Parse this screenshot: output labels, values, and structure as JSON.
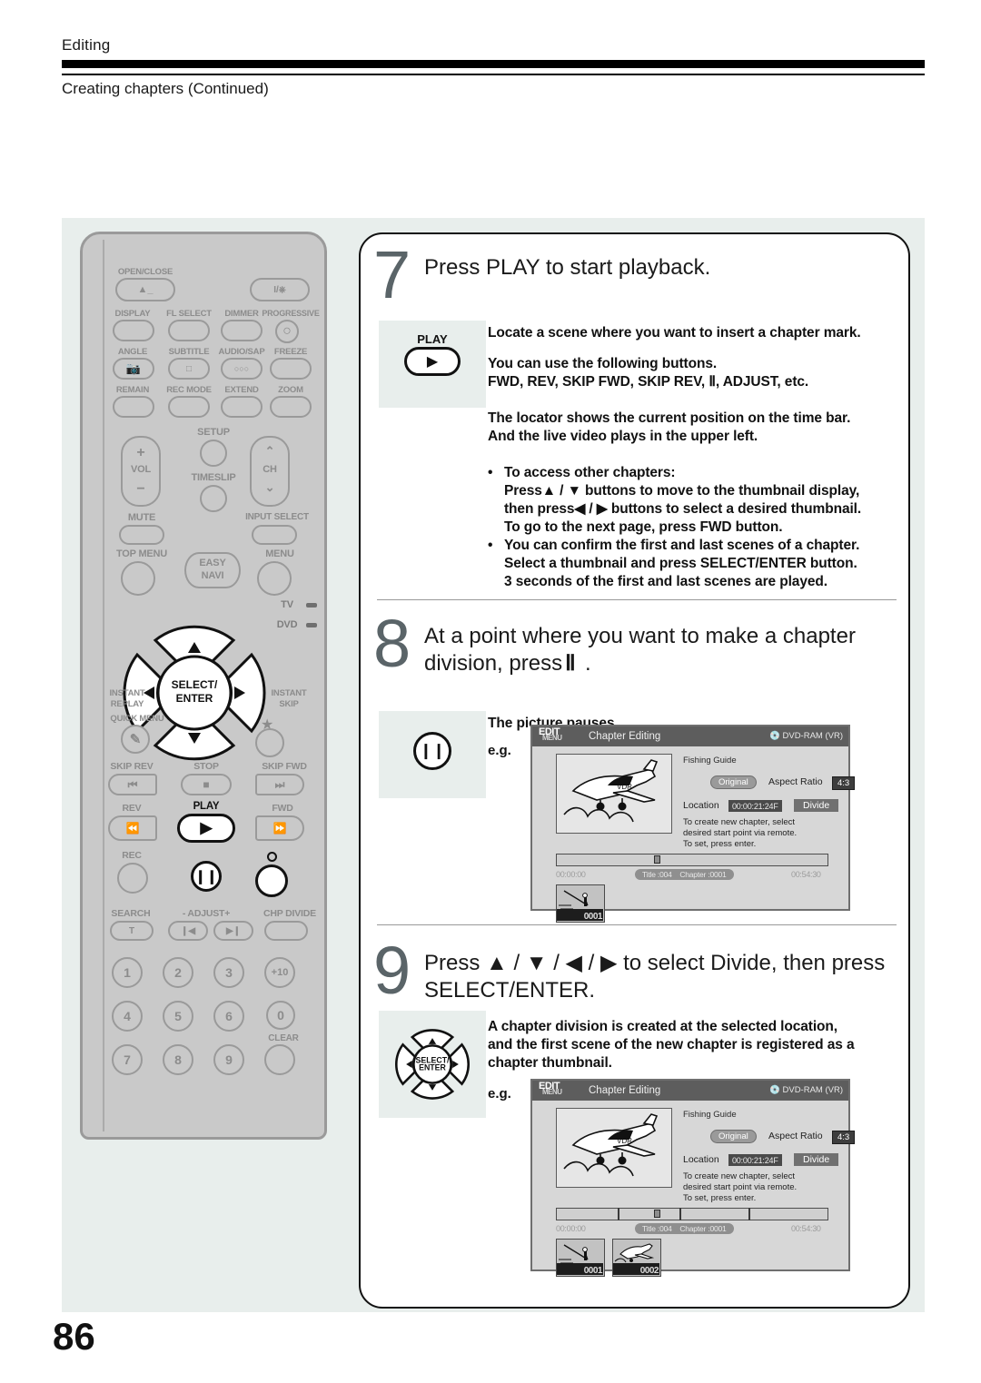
{
  "header": {
    "section": "Editing",
    "subtitle": "Creating chapters (Continued)"
  },
  "page_number": "86",
  "remote": {
    "groups": [
      {
        "label": "OPEN/CLOSE",
        "icon": "eject-icon"
      },
      {
        "label": "",
        "icon": "power-icon",
        "glyph": "I/⏻"
      },
      {
        "label": "DISPLAY"
      },
      {
        "label": "FL SELECT"
      },
      {
        "label": "DIMMER"
      },
      {
        "label": "PROGRESSIVE"
      },
      {
        "label": "ANGLE",
        "icon": "camera-icon"
      },
      {
        "label": "SUBTITLE",
        "icon": "subtitle-icon"
      },
      {
        "label": "AUDIO/SAP",
        "icon": "audio-icon"
      },
      {
        "label": "FREEZE"
      },
      {
        "label": "REMAIN"
      },
      {
        "label": "REC MODE"
      },
      {
        "label": "EXTEND"
      },
      {
        "label": "ZOOM"
      },
      {
        "label": "VOL"
      },
      {
        "label": "SETUP"
      },
      {
        "label": "TIMESLIP"
      },
      {
        "label": "CH"
      },
      {
        "label": "MUTE"
      },
      {
        "label": "INPUT SELECT"
      },
      {
        "label": "TOP MENU"
      },
      {
        "label": "EASY NAVI"
      },
      {
        "label": "MENU"
      },
      {
        "label": "SELECT/ENTER"
      },
      {
        "label": "INSTANT REPLAY"
      },
      {
        "label": "INSTANT SKIP"
      },
      {
        "label": "QUICK MENU"
      },
      {
        "label": "SKIP REV"
      },
      {
        "label": "STOP"
      },
      {
        "label": "SKIP FWD"
      },
      {
        "label": "REV"
      },
      {
        "label": "PLAY"
      },
      {
        "label": "FWD"
      },
      {
        "label": "REC"
      },
      {
        "label": "SEARCH"
      },
      {
        "label": "- ADJUST+"
      },
      {
        "label": "CHP DIVIDE"
      },
      {
        "label": "CLEAR"
      }
    ],
    "labels": {
      "open_close": "OPEN/CLOSE",
      "display": "DISPLAY",
      "fl_select": "FL SELECT",
      "dimmer": "DIMMER",
      "progressive": "PROGRESSIVE",
      "angle": "ANGLE",
      "subtitle": "SUBTITLE",
      "audio_sap": "AUDIO/SAP",
      "freeze": "FREEZE",
      "remain": "REMAIN",
      "rec_mode": "REC MODE",
      "extend": "EXTEND",
      "zoom": "ZOOM",
      "vol": "VOL",
      "setup": "SETUP",
      "timeslip": "TIMESLIP",
      "ch": "CH",
      "mute": "MUTE",
      "input_select": "INPUT SELECT",
      "top_menu": "TOP MENU",
      "easy": "EASY",
      "navi": "NAVI",
      "menu": "MENU",
      "select": "SELECT/",
      "enter": "ENTER",
      "tv": "TV",
      "dvd": "DVD",
      "instant": "INSTANT",
      "replay": "REPLAY",
      "instant2": "INSTANT",
      "skip": "SKIP",
      "quick_menu": "QUICK MENU",
      "skip_rev": "SKIP REV",
      "stop": "STOP",
      "skip_fwd": "SKIP FWD",
      "rev": "REV",
      "play": "PLAY",
      "fwd": "FWD",
      "rec": "REC",
      "search": "SEARCH",
      "adjust": "- ADJUST+",
      "chp_divide": "CHP DIVIDE",
      "clear": "CLEAR",
      "search_glyph": "T",
      "plus": "+",
      "minus": "−",
      "chev_up": "⌃",
      "chev_down": "⌄"
    },
    "keypad": [
      "1",
      "2",
      "3",
      "+10",
      "4",
      "5",
      "6",
      "0",
      "7",
      "8",
      "9"
    ]
  },
  "steps": [
    {
      "num": "7",
      "title": "Press PLAY to start playback.",
      "icon_label": "PLAY",
      "body": [
        "Locate a scene where you want to insert a chapter mark.",
        "You can use the following buttons.",
        "FWD, REV, SKIP FWD, SKIP REV, Ⅱ, ADJUST, etc.",
        "The locator shows the current position on the time bar.",
        "And the live video plays in the upper left."
      ],
      "bullets": [
        "To access other chapters:",
        "Press▲ / ▼ buttons to move to the thumbnail display,",
        "then press◀ / ▶ buttons to select a desired thumbnail.",
        "To go to the next page, press FWD button.",
        "You can confirm the first and last scenes of a chapter.",
        "Select a thumbnail and press SELECT/ENTER button.",
        "3 seconds of the first and last scenes are played."
      ]
    },
    {
      "num": "8",
      "title_line1": "At a point where you want to make a chapter",
      "title_line2": "division, press",
      "title_glyph": "Ⅱ",
      "title_end": ".",
      "body": [
        "The picture pauses."
      ],
      "eg": "e.g."
    },
    {
      "num": "9",
      "title_line1": "Press ▲ / ▼ / ◀ / ▶ to select  Divide,  then press",
      "title_line2": "SELECT/ENTER.",
      "body": [
        "A chapter division is created at the selected location,",
        "and the first scene of the new chapter is registered as a",
        "chapter thumbnail."
      ],
      "eg": "e.g."
    }
  ],
  "tv_screens": [
    {
      "edit": "EDIT",
      "menu": "MENU",
      "title": "Chapter Editing",
      "disc": "DVD-RAM (VR)",
      "program": "Fishing Guide",
      "original": "Original",
      "aspect_label": "Aspect Ratio",
      "aspect_value": "4:3",
      "location_label": "Location",
      "location_value": "00:00:21:24F",
      "divide": "Divide",
      "hint_line1": "To create new chapter, select",
      "hint_line2": "desired start point via remote.",
      "hint_line3": "To set, press enter.",
      "time_start": "00:00:00",
      "time_end": "00:54:30",
      "chip_title": "Title :004",
      "chip_chapter": "Chapter :0001",
      "thumbnails": [
        "0001"
      ]
    },
    {
      "edit": "EDIT",
      "menu": "MENU",
      "title": "Chapter Editing",
      "disc": "DVD-RAM (VR)",
      "program": "Fishing Guide",
      "original": "Original",
      "aspect_label": "Aspect Ratio",
      "aspect_value": "4:3",
      "location_label": "Location",
      "location_value": "00:00:21:24F",
      "divide": "Divide",
      "hint_line1": "To create new chapter, select",
      "hint_line2": "desired start point via remote.",
      "hint_line3": "To set, press enter.",
      "time_start": "00:00:00",
      "time_end": "00:54:30",
      "chip_title": "Title :004",
      "chip_chapter": "Chapter :0001",
      "thumbnails": [
        "0001",
        "0002"
      ]
    }
  ]
}
